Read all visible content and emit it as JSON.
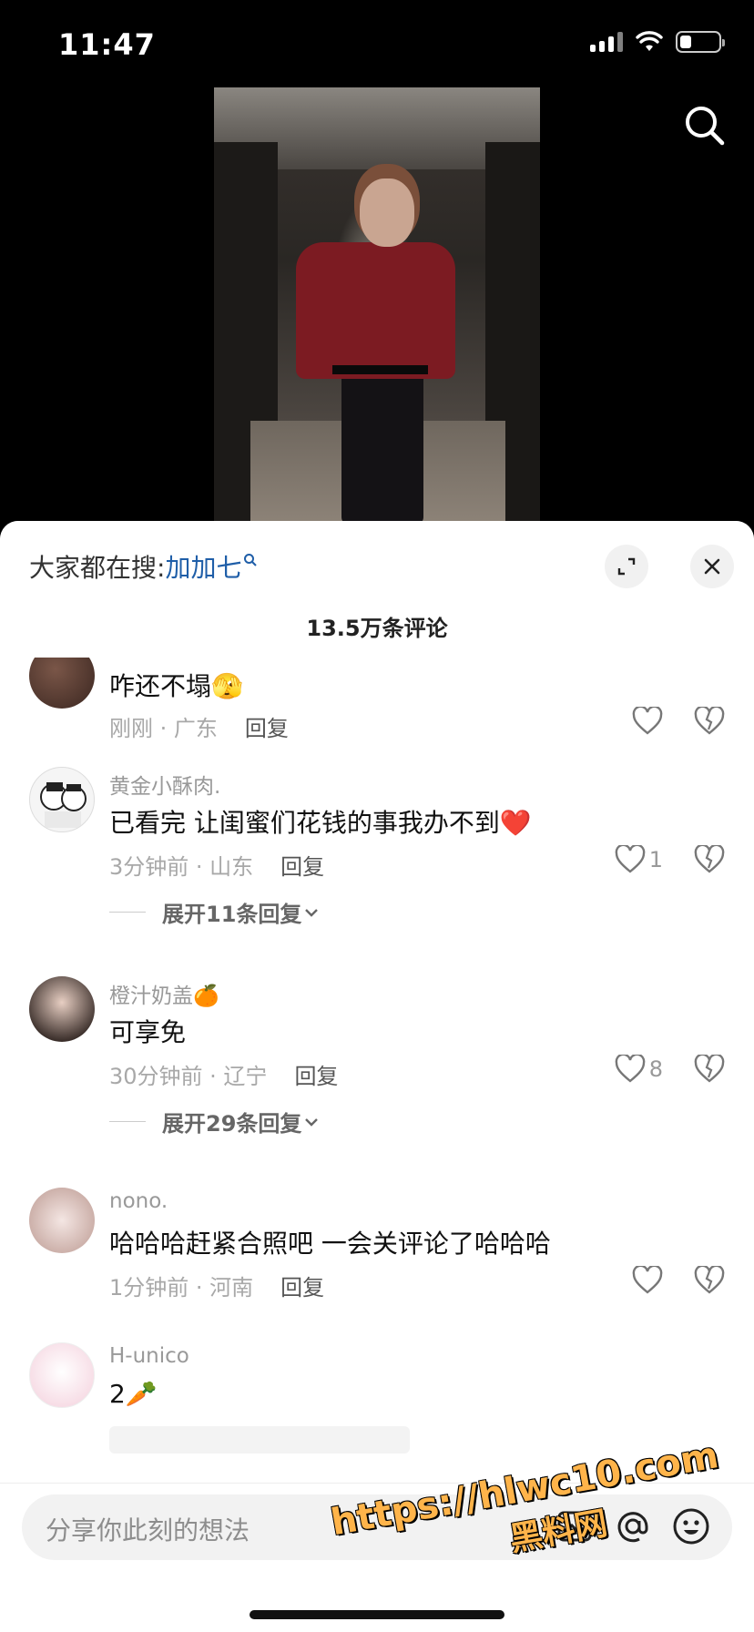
{
  "status_bar": {
    "time": "11:47"
  },
  "hot_search": {
    "prefix": "大家都在搜:",
    "keyword": "加加七"
  },
  "comment_count": "13.5万条评论",
  "comments": [
    {
      "name": "",
      "text": "咋还不塌",
      "emoji": "🫣",
      "time_loc": "刚刚 · 广东",
      "reply": "回复",
      "likes": ""
    },
    {
      "name": "黄金小酥肉.",
      "text": "已看完 让闺蜜们花钱的事我办不到",
      "emoji": "❤️",
      "time_loc": "3分钟前 · 山东",
      "reply": "回复",
      "likes": "1",
      "expand": "展开11条回复"
    },
    {
      "name": "橙汁奶盖",
      "name_emoji": "🍊",
      "text": "可享免",
      "time_loc": "30分钟前 · 辽宁",
      "reply": "回复",
      "likes": "8",
      "expand": "展开29条回复"
    },
    {
      "name": "nono.",
      "text": "哈哈哈赶紧合照吧 一会关评论了哈哈哈",
      "time_loc": "1分钟前 · 河南",
      "reply": "回复",
      "likes": ""
    },
    {
      "name": "H-unico",
      "text": "2",
      "emoji": "🥕"
    }
  ],
  "input": {
    "placeholder": "分享你此刻的想法"
  },
  "watermark": {
    "url": "https://hlwc10.com",
    "site": "黑料网"
  },
  "colors": {
    "keyword": "#1f5ea8",
    "watermark": "#ffb44a"
  }
}
